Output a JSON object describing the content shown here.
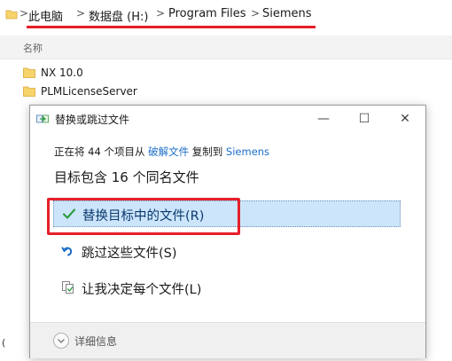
{
  "explorer": {
    "breadcrumbs": [
      "此电脑",
      "数据盘 (H:)",
      "Program Files",
      "Siemens"
    ],
    "separator": ">",
    "column_name": "名称",
    "folders": [
      "NX 10.0",
      "PLMLicenseServer"
    ],
    "stray_char": "("
  },
  "dialog": {
    "title": "替换或跳过文件",
    "progress": {
      "prefix": "正在将 44 个项目从",
      "source": "破解文件",
      "middle": "复制到",
      "dest": "Siemens"
    },
    "heading": "目标包含 16 个同名文件",
    "options": [
      {
        "label": "替换目标中的文件(R)",
        "icon": "checkmark-icon",
        "selected": true
      },
      {
        "label": "跳过这些文件(S)",
        "icon": "skip-arrow-icon",
        "selected": false
      },
      {
        "label": "让我决定每个文件(L)",
        "icon": "decide-files-icon",
        "selected": false
      }
    ],
    "details_label": "详细信息",
    "window_buttons": {
      "minimize": "—",
      "maximize": "☐",
      "close": "✕"
    }
  },
  "colors": {
    "highlight_red": "#e5202a",
    "link_blue": "#1c6ec8",
    "selected_bg": "#cce5fb",
    "check_green": "#2e9e3e",
    "folder_yellow": "#f7d36b"
  }
}
